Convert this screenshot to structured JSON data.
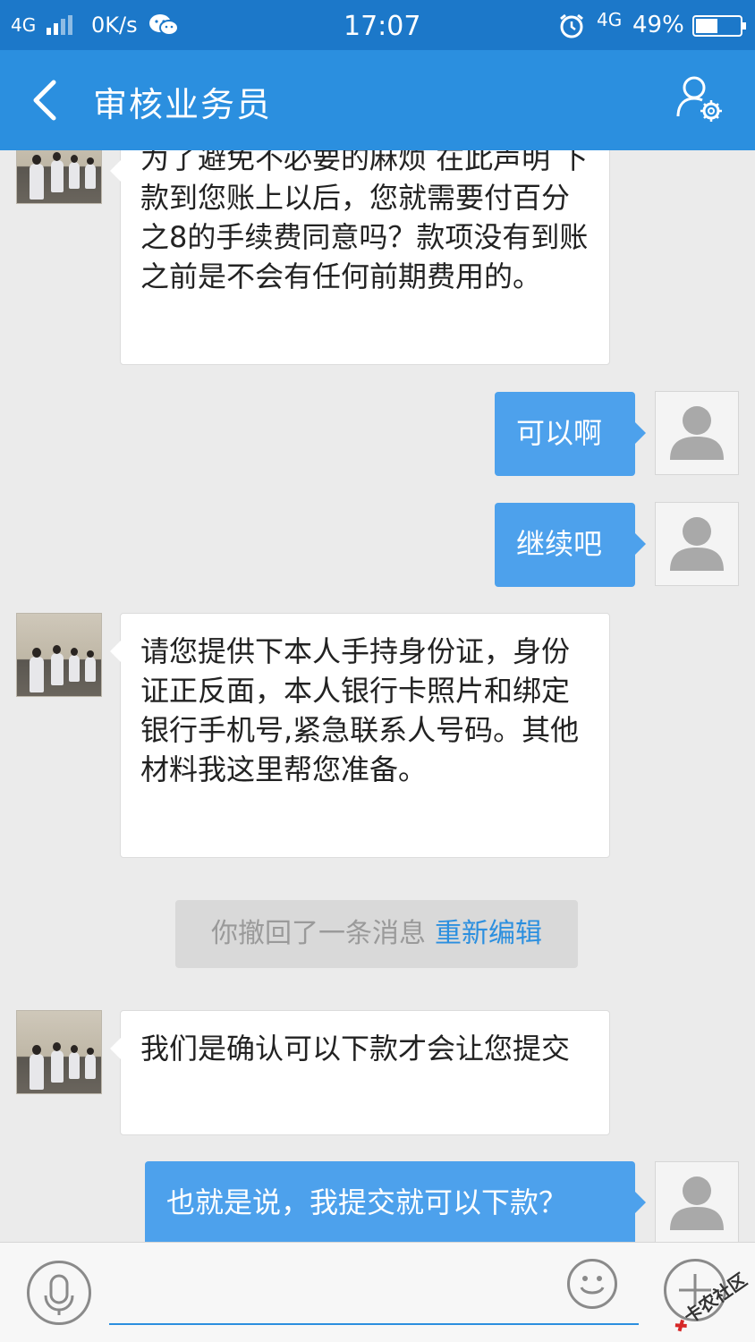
{
  "status_bar": {
    "network": "4G",
    "speed": "0K/s",
    "time": "17:07",
    "network2": "4G",
    "battery": "49%",
    "icons": [
      "signal-icon",
      "wechat-icon",
      "alarm-icon",
      "battery-icon"
    ]
  },
  "nav": {
    "title": "审核业务员",
    "icons": [
      "back-icon",
      "profile-settings-icon"
    ]
  },
  "messages": [
    {
      "side": "in",
      "text": "为了避免不必要的麻烦 在此声明  下款到您账上以后，您就需要付百分之8的手续费同意吗？款项没有到账之前是不会有任何前期费用的。"
    },
    {
      "side": "out",
      "text": "可以啊"
    },
    {
      "side": "out",
      "text": "继续吧"
    },
    {
      "side": "in",
      "text": "请您提供下本人手持身份证，身份证正反面，本人银行卡照片和绑定银行手机号,紧急联系人号码。其他材料我这里帮您准备。"
    },
    {
      "side": "in",
      "text": "我们是确认可以下款才会让您提交"
    },
    {
      "side": "out",
      "text": "也就是说，我提交就可以下款？"
    }
  ],
  "recall_notice": {
    "text": "你撤回了一条消息",
    "action": "重新编辑"
  },
  "input_bar": {
    "placeholder": "",
    "icons": [
      "microphone-icon",
      "emoji-icon",
      "plus-icon"
    ]
  },
  "watermark": {
    "text": "卡农社区"
  },
  "colors": {
    "status_bar": "#1c78c9",
    "nav_bar": "#2b8fdf",
    "outgoing_bubble": "#4da1ec",
    "background": "#ebebeb"
  }
}
